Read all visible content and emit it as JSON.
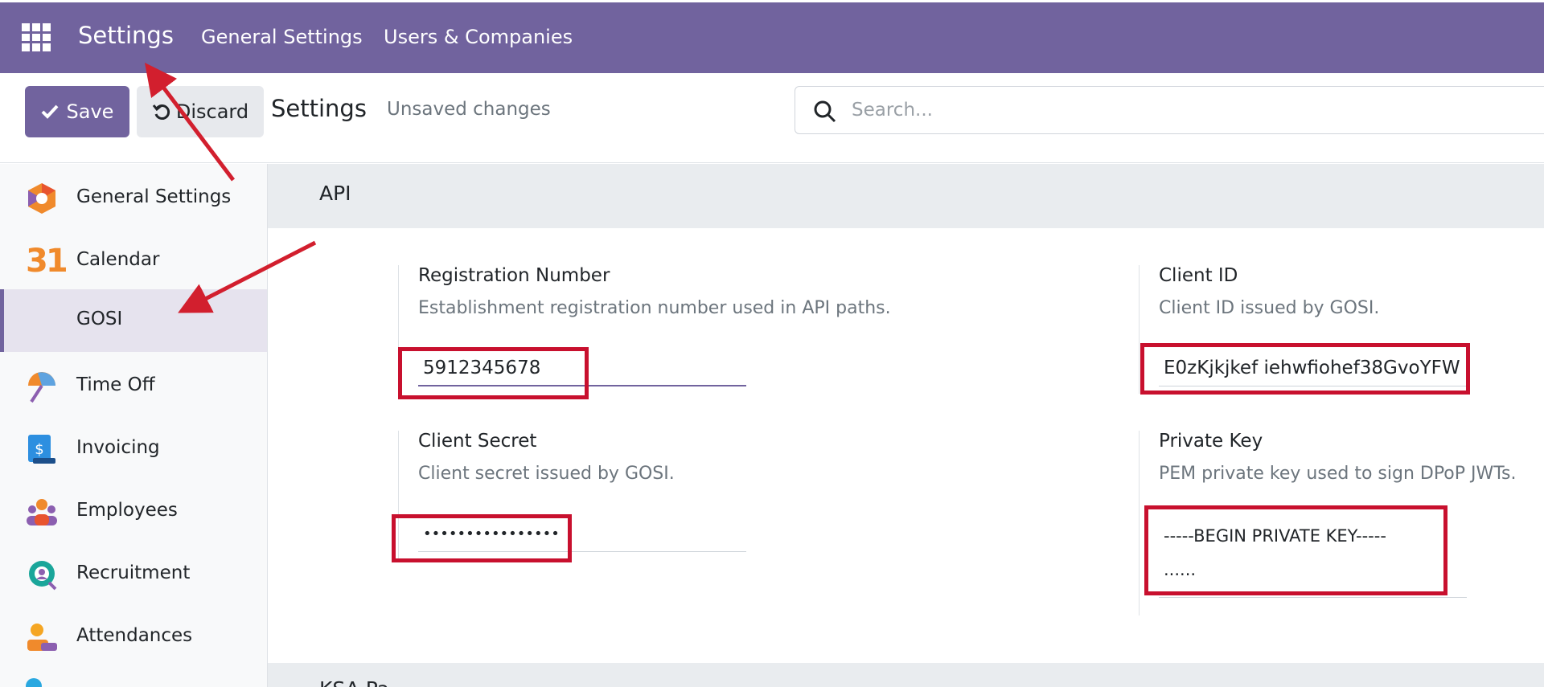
{
  "navbar": {
    "apps_icon": "apps-grid-icon",
    "brand": "Settings",
    "menu": [
      "General Settings",
      "Users & Companies"
    ]
  },
  "control_panel": {
    "save_label": "Save",
    "discard_label": "Discard",
    "title": "Settings",
    "status": "Unsaved changes",
    "search_placeholder": "Search..."
  },
  "sidebar": {
    "items": [
      {
        "label": "General Settings",
        "icon": "general-settings-icon"
      },
      {
        "label": "Calendar",
        "icon": "calendar-icon"
      },
      {
        "label": "GOSI",
        "icon": "",
        "active": true
      },
      {
        "label": "Time Off",
        "icon": "time-off-icon"
      },
      {
        "label": "Invoicing",
        "icon": "invoicing-icon"
      },
      {
        "label": "Employees",
        "icon": "employees-icon"
      },
      {
        "label": "Recruitment",
        "icon": "recruitment-icon"
      },
      {
        "label": "Attendances",
        "icon": "attendances-icon"
      }
    ],
    "calendar_icon_text": "31"
  },
  "main": {
    "section_title": "API",
    "next_section_title": "KSA Pa...",
    "fields": {
      "registration_number": {
        "label": "Registration Number",
        "help": "Establishment registration number used in API paths.",
        "value": "5912345678"
      },
      "client_id": {
        "label": "Client ID",
        "help": "Client ID issued by GOSI.",
        "value": "E0zKjkjkef iehwfiohef38GvoYFW"
      },
      "client_secret": {
        "label": "Client Secret",
        "help": "Client secret issued by GOSI.",
        "value": "••••••••••••••••"
      },
      "private_key": {
        "label": "Private Key",
        "help": "PEM private key used to sign DPoP JWTs.",
        "value": "-----BEGIN PRIVATE KEY-----\n......"
      }
    }
  },
  "colors": {
    "brand": "#71639e",
    "annotation": "#c8102e"
  }
}
